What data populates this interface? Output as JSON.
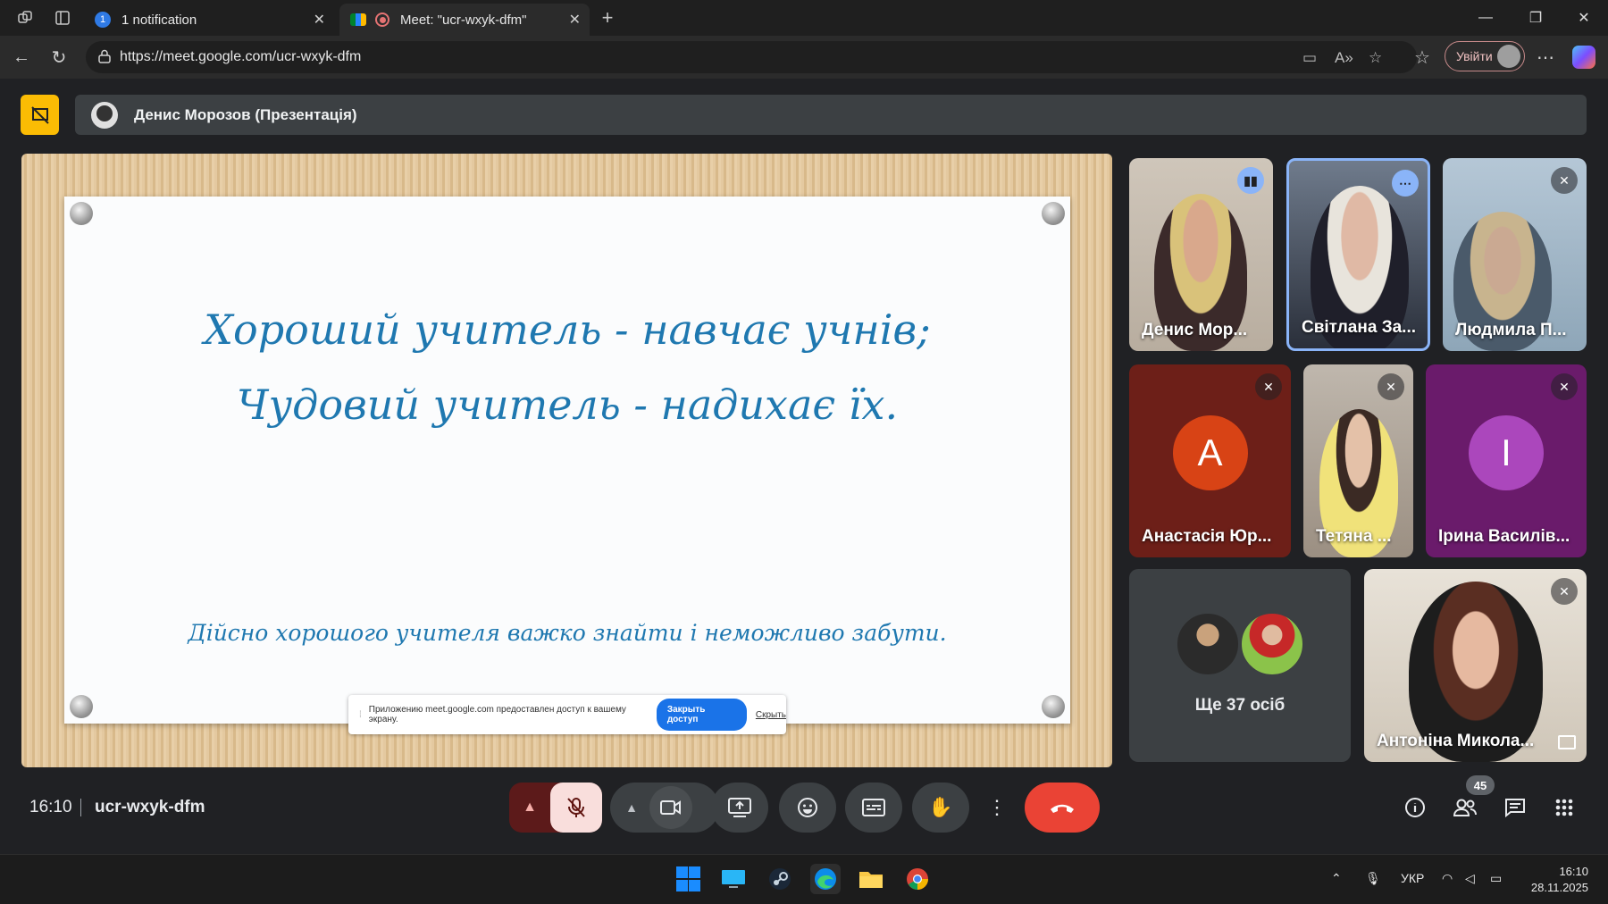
{
  "browser": {
    "tabs": [
      {
        "label": "1 notification",
        "badge": "1",
        "active": false
      },
      {
        "label": "Meet: \"ucr-wxyk-dfm\"",
        "active": true
      }
    ],
    "url": "https://meet.google.com/ucr-wxyk-dfm",
    "signin_label": "Увійти"
  },
  "meet": {
    "presenter_label": "Денис Морозов (Презентація)",
    "slide": {
      "line1": "Хороший учитель - навчає учнів;",
      "line2": "Чудовий учитель - надихає їх.",
      "line3": "Дійсно хорошого учителя важко знайти і неможливо забути."
    },
    "share_notice": {
      "text": "Приложению meet.google.com предоставлен доступ к вашему экрану.",
      "stop_label": "Закрыть доступ",
      "hide_label": "Скрыть"
    },
    "participants": [
      {
        "name": "Денис Мор...",
        "state": "speaking"
      },
      {
        "name": "Світлана За...",
        "state": "active"
      },
      {
        "name": "Людмила П...",
        "state": "muted"
      },
      {
        "name": "Анастасія Юр...",
        "state": "muted",
        "initial": "A",
        "color": "#d84315"
      },
      {
        "name": "Тетяна ...",
        "state": "muted"
      },
      {
        "name": "Ірина Василів...",
        "state": "muted",
        "initial": "I",
        "color": "#ab47bc"
      },
      {
        "name": "Антоніна Микола...",
        "state": "muted"
      }
    ],
    "more_people_label": "Ще 37 осіб",
    "time": "16:10",
    "meeting_code": "ucr-wxyk-dfm",
    "people_count": "45"
  },
  "taskbar": {
    "language": "УКР",
    "time": "16:10",
    "date": "28.11.2025"
  }
}
